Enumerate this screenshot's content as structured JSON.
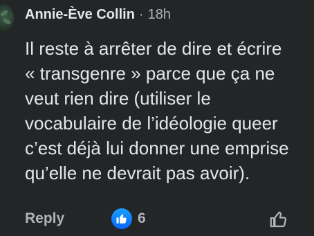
{
  "comment": {
    "author": "Annie-Ève Collin",
    "separator": "·",
    "time": "18h",
    "lines": [
      "Il reste à arrêter de dire et écrire",
      "« transgenre » parce que ça ne",
      "veut rien dire (utiliser le",
      "vocabulaire de l’idéologie queer",
      "c’est déjà lui donner une emprise",
      "qu’elle ne devrait pas avoir)."
    ]
  },
  "actions": {
    "reply_label": "Reply",
    "reaction_icon": "like-reaction-icon",
    "reaction_count": "6",
    "like_icon": "thumbs-up-outline-icon"
  },
  "colors": {
    "background": "#242526",
    "text": "#e4e6eb",
    "secondary_text": "#b0b3b8",
    "like_blue": "#0866ff"
  }
}
